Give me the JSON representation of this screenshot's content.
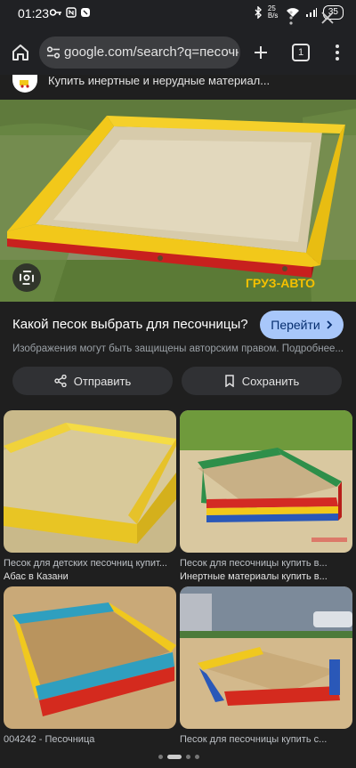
{
  "status_bar": {
    "time": "01:23",
    "net_speed": "25\nB/s",
    "battery": "35"
  },
  "browser": {
    "url": "google.com/search?q=песочни",
    "tab_count": "1"
  },
  "source": {
    "title": "Купить инертные и нерудные материал..."
  },
  "hero": {
    "watermark": "ГРУЗ-АВТО"
  },
  "result": {
    "title": "Какой песок выбрать для песочницы?",
    "go_label": "Перейти",
    "copyright": "Изображения могут быть защищены авторским правом. Подробнее..."
  },
  "actions": {
    "share_label": "Отправить",
    "save_label": "Сохранить"
  },
  "related": [
    {
      "caption": "Песок для детских песочниц купит...",
      "source": "Абас в Казани"
    },
    {
      "caption": "Песок для песочницы купить в...",
      "source": "Инертные материалы купить в..."
    },
    {
      "caption": "004242 - Песочница",
      "source": ""
    },
    {
      "caption": "Песок для песочницы купить с...",
      "source": ""
    }
  ],
  "colors": {
    "accent": "#a8c7fa",
    "background": "#1f1f1f",
    "sandbox_yellow": "#f2c81a",
    "sandbox_red": "#c8201e"
  }
}
